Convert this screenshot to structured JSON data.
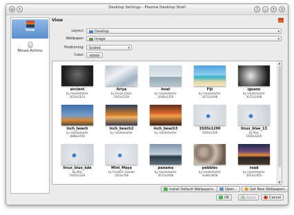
{
  "window": {
    "title": "Desktop Settings - Plasma Desktop Shell",
    "help_label": "?",
    "minimize_label": "–",
    "maximize_label": "+",
    "close_label": "×"
  },
  "sidebar": {
    "items": [
      {
        "label": "View"
      },
      {
        "label": "Mouse Actions"
      }
    ]
  },
  "view": {
    "header": "View",
    "layout_label": "Layout:",
    "layout_value": "Desktop",
    "wallpaper_label": "Wallpaper:",
    "wallpaper_value": "Image",
    "positioning_label": "Positioning:",
    "positioning_value": "Scaled",
    "color_label": "Color:"
  },
  "wallpapers": [
    {
      "name": "ancient",
      "author": "by masterbutler",
      "size": "3024x2023"
    },
    {
      "name": "Ariya",
      "author": "by Emad Zakar",
      "size": "1920x1200"
    },
    {
      "name": "boat",
      "author": "by masterbutler",
      "size": "2048x1359"
    },
    {
      "name": "Fiji",
      "author": "by masterbutler",
      "size": "3072x2048"
    },
    {
      "name": "iguazu",
      "author": "by masterbutler",
      "size": "3072x2048"
    },
    {
      "name": "inch_beach",
      "author": "by masterbutler",
      "size": "3888x2592"
    },
    {
      "name": "inch_beach2",
      "author": "by masterbutler",
      "size": ""
    },
    {
      "name": "inch_beach3",
      "author": "by masterbutler",
      "size": ""
    },
    {
      "name": "1920x1200",
      "author": "",
      "size": "1920x1200"
    },
    {
      "name": "linux_blue_13",
      "author": "by Mac",
      "size": "1920x1200"
    },
    {
      "name": "linux_blue_kde",
      "author": "by Mac",
      "size": "1920x1200"
    },
    {
      "name": "Mint_Maya",
      "author": "by Frederic Gaudet",
      "size": "1024x768"
    },
    {
      "name": "panama",
      "author": "by masterbutler",
      "size": "3072x2048"
    },
    {
      "name": "pebbles",
      "author": "by masterbutler",
      "size": "4x48x3008"
    },
    {
      "name": "road",
      "author": "by masterbutler",
      "size": "3953x2665"
    }
  ],
  "buttons": {
    "install_default": "Install Default Wallpapers...",
    "open": "Open...",
    "get_new": "Get New Wallpapers...",
    "ok": "OK",
    "cancel": "Cancel",
    "apply": "Apply"
  },
  "colors": {
    "accent": "#5b8fd0",
    "window_bg": "#ececec"
  }
}
